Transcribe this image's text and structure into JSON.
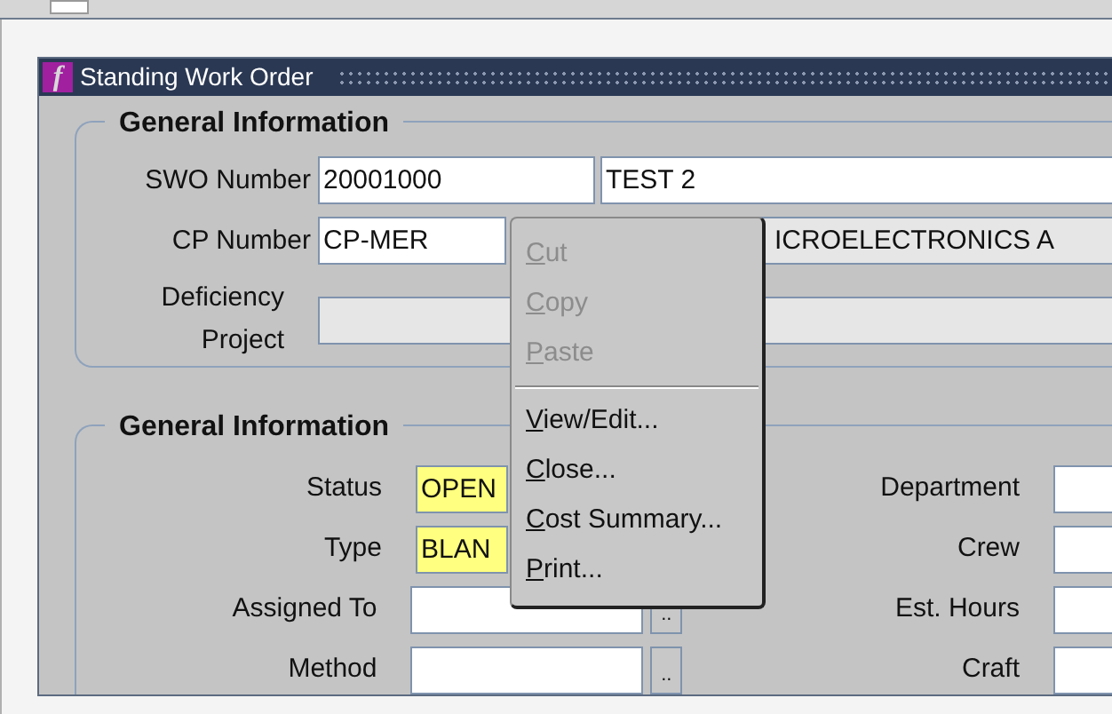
{
  "window": {
    "logo_letter": "f",
    "title": "Standing Work Order"
  },
  "top_section": {
    "title": "General Information",
    "rows": [
      {
        "label": "SWO Number",
        "fields": [
          {
            "value": "20001000",
            "readonly": false
          },
          {
            "value": "TEST 2",
            "readonly": false
          }
        ]
      },
      {
        "label": "CP Number",
        "fields": [
          {
            "value": "CP-MER",
            "readonly": false
          },
          {
            "value": "ICROELECTRONICS A",
            "readonly": true
          }
        ]
      },
      {
        "label": "Deficiency Project",
        "fields": [
          {
            "readonly": true
          }
        ]
      }
    ]
  },
  "bottom_section": {
    "title": "General Information",
    "left_rows": [
      {
        "label": "Status",
        "value": "OPEN",
        "required": true
      },
      {
        "label": "Type",
        "value": "BLAN",
        "required": true
      },
      {
        "label": "Assigned To",
        "value": "",
        "required": false,
        "lov_button": ".."
      },
      {
        "label": "Method",
        "value": "",
        "required": false,
        "lov_button": ".."
      }
    ],
    "right_rows": [
      {
        "label": "Department"
      },
      {
        "label": "Crew"
      },
      {
        "label": "Est. Hours"
      },
      {
        "label": "Craft"
      }
    ]
  },
  "context_menu": {
    "items": [
      {
        "kind": "item",
        "label": "Cut",
        "disabled": true
      },
      {
        "kind": "item",
        "label": "Copy",
        "disabled": true
      },
      {
        "kind": "item",
        "label": "Paste",
        "disabled": true
      },
      {
        "kind": "separator"
      },
      {
        "kind": "item",
        "label": "View/Edit...",
        "disabled": false
      },
      {
        "kind": "item",
        "label": "Close...",
        "disabled": false
      },
      {
        "kind": "item",
        "label": "Cost Summary...",
        "disabled": false
      },
      {
        "kind": "item",
        "label": "Print...",
        "disabled": false
      }
    ]
  }
}
